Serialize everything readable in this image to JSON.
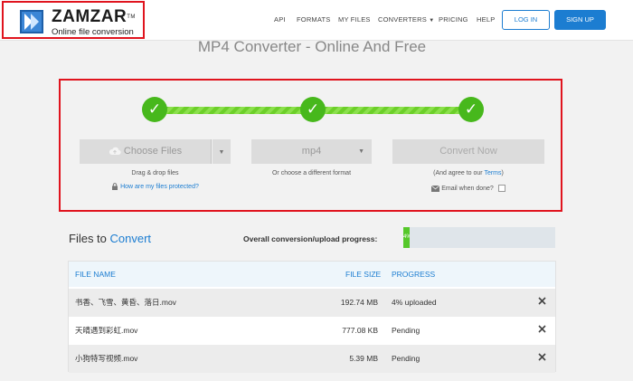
{
  "header": {
    "logo": {
      "name": "ZAMZAR",
      "tm": "TM",
      "tagline": "Online file conversion"
    },
    "nav": [
      {
        "label": "API"
      },
      {
        "label": "FORMATS"
      },
      {
        "label": "MY FILES"
      },
      {
        "label": "CONVERTERS"
      },
      {
        "label": "PRICING"
      },
      {
        "label": "HELP"
      }
    ],
    "login_label": "LOG IN",
    "signup_label": "SIGN UP"
  },
  "page_title": "MP4 Converter - Online And Free",
  "converter": {
    "step_check": "✓",
    "choose_files": {
      "label": "Choose Files",
      "note": "Drag & drop files",
      "protected_link": "How are my files protected?"
    },
    "format": {
      "value": "mp4",
      "note": "Or choose a different format"
    },
    "convert": {
      "label": "Convert Now",
      "note_prefix": "(And agree to our ",
      "terms_link": "Terms",
      "note_suffix": ")",
      "email_label": "Email when done?"
    }
  },
  "files": {
    "title_prefix": "Files to ",
    "title_accent": "Convert",
    "progress_label": "Overall conversion/upload progress:",
    "progress_text": "4%",
    "progress_fraction": 0.04,
    "columns": {
      "name": "FILE NAME",
      "size": "FILE SIZE",
      "progress": "PROGRESS"
    },
    "rows": [
      {
        "name": "书香、飞雪、黄昏、落日.mov",
        "size": "192.74 MB",
        "progress": "4% uploaded"
      },
      {
        "name": "天晴遇到彩虹.mov",
        "size": "777.08 KB",
        "progress": "Pending"
      },
      {
        "name": "小狗特写视频.mov",
        "size": "5.39 MB",
        "progress": "Pending"
      }
    ]
  },
  "colors": {
    "accent": "#1c7dd1",
    "success": "#47b81c",
    "highlight": "#e0141e"
  }
}
